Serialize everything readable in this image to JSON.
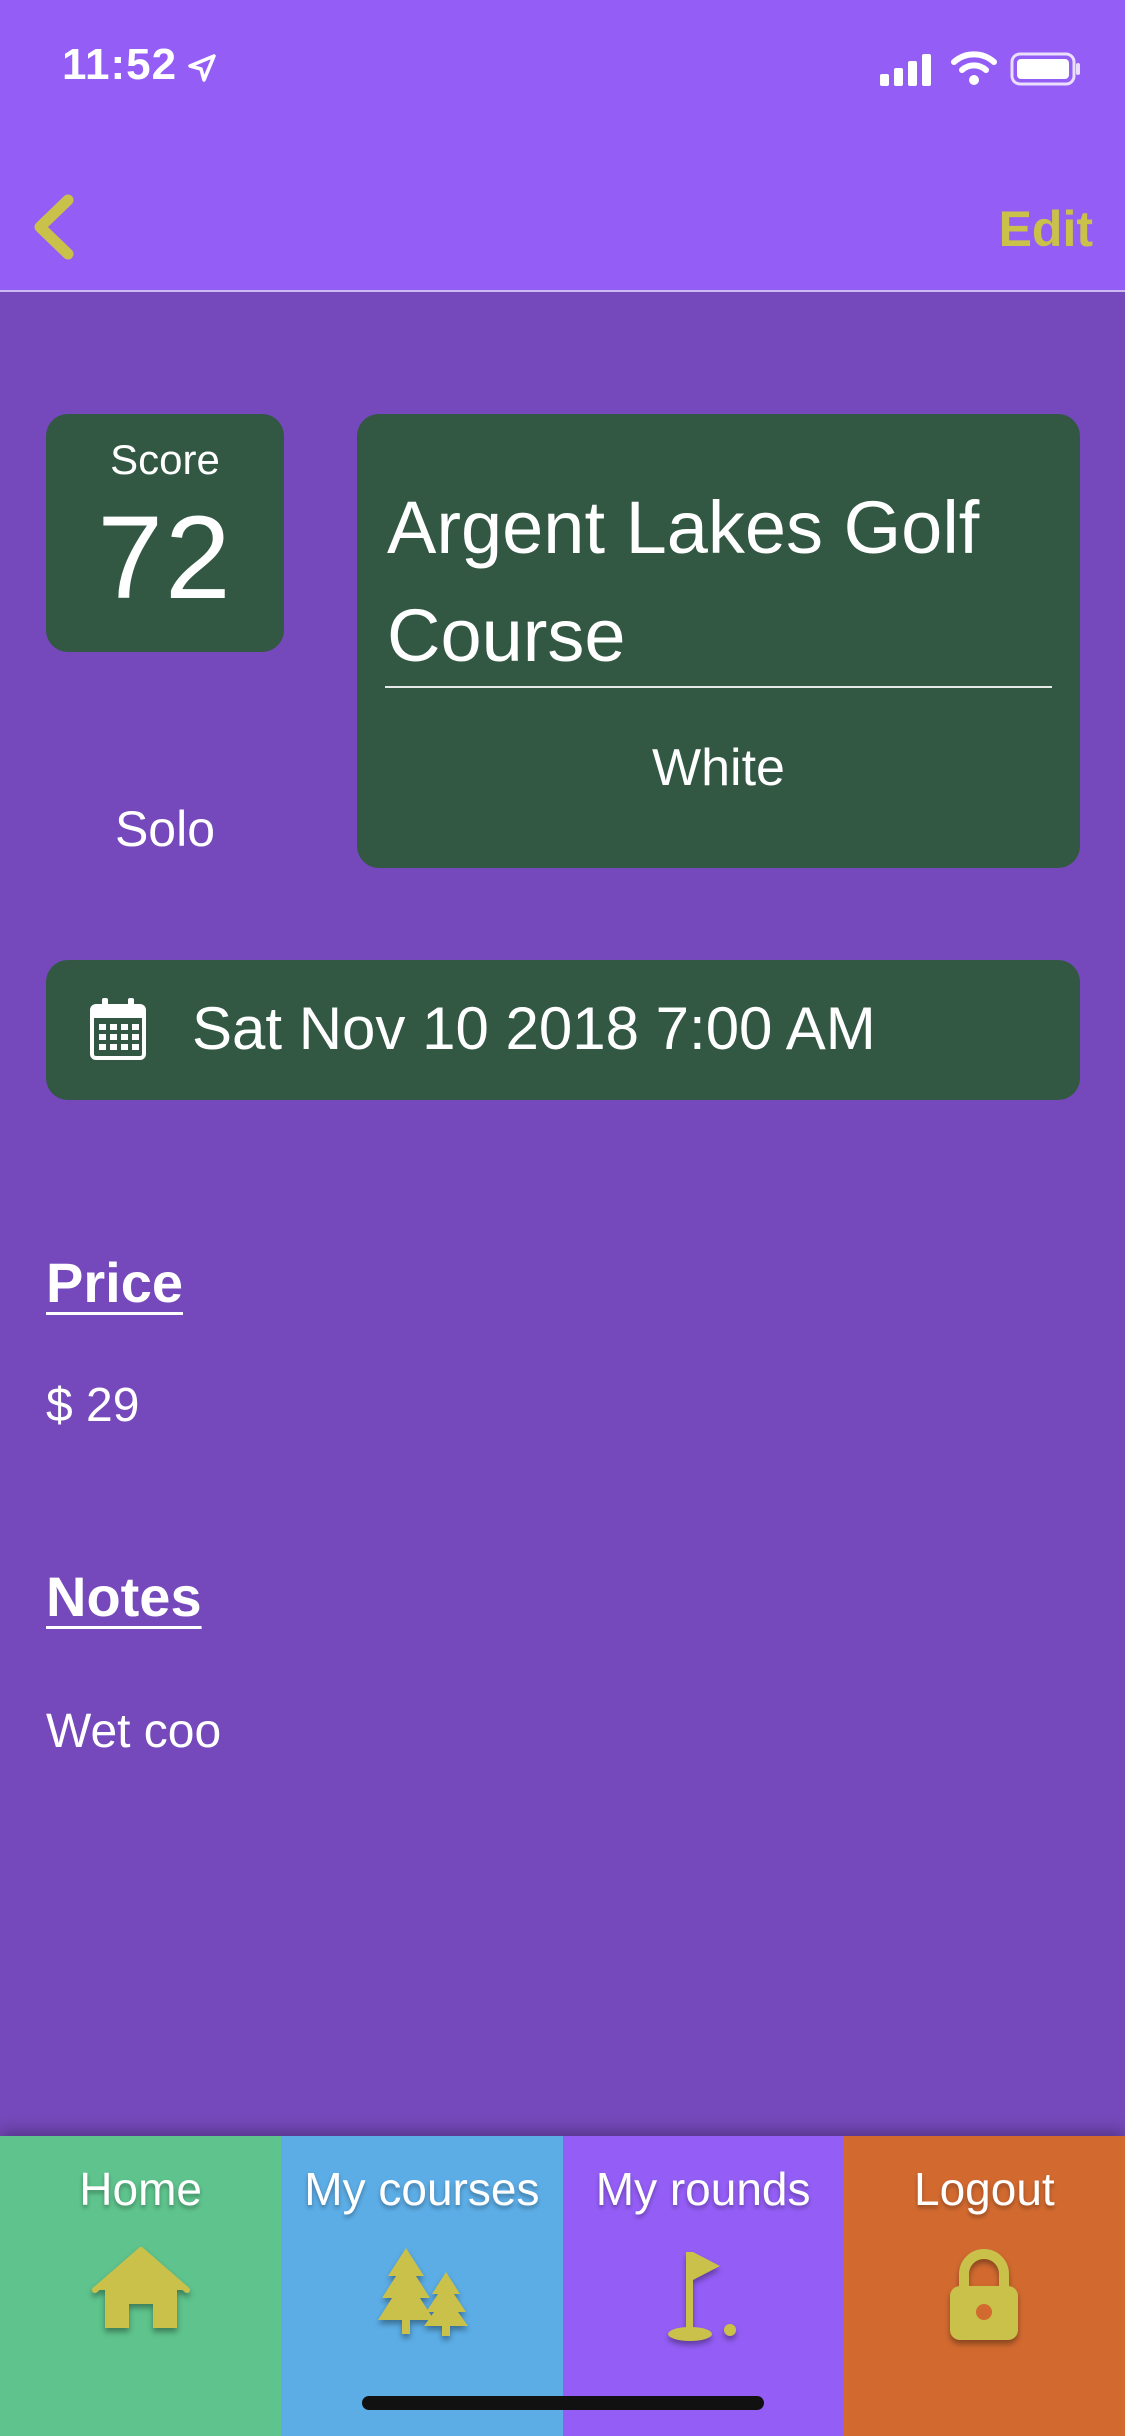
{
  "status_bar": {
    "time": "11:52"
  },
  "nav": {
    "back_icon": "chevron-left-icon",
    "edit_label": "Edit"
  },
  "score": {
    "label": "Score",
    "value": "72"
  },
  "round_type": "Solo",
  "course": {
    "name": "Argent Lakes Golf Course",
    "tee": "White"
  },
  "date": {
    "icon": "calendar-icon",
    "text": "Sat Nov 10 2018 7:00 AM"
  },
  "price": {
    "label": "Price",
    "value": "$ 29"
  },
  "notes": {
    "label": "Notes",
    "value": "Wet coo"
  },
  "tabs": [
    {
      "label": "Home",
      "icon": "house-icon",
      "color": "#5ec38c"
    },
    {
      "label": "My courses",
      "icon": "trees-icon",
      "color": "#5cade6"
    },
    {
      "label": "My rounds",
      "icon": "golf-flag-icon",
      "color": "#945ef6"
    },
    {
      "label": "Logout",
      "icon": "lock-icon",
      "color": "#d26a30"
    }
  ],
  "colors": {
    "background": "#7549bb",
    "header": "#945ef6",
    "card": "#325844",
    "accent": "#c9c14a"
  }
}
